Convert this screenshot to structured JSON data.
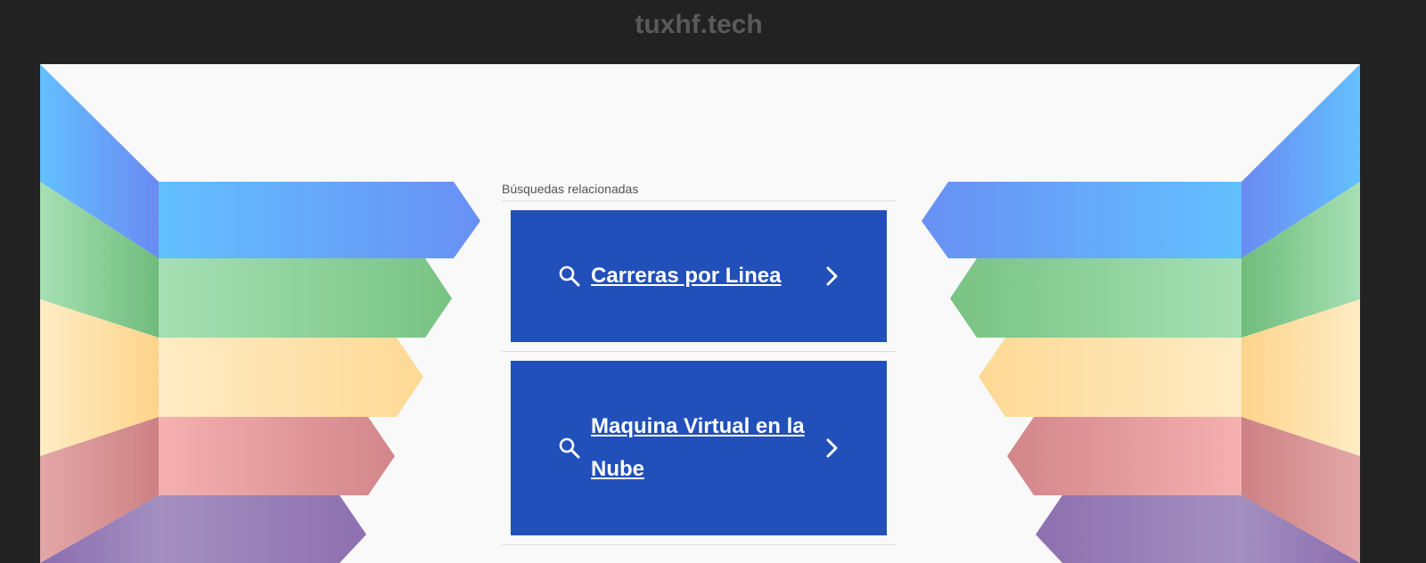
{
  "site": {
    "title": "tuxhf.tech"
  },
  "related": {
    "heading": "Búsquedas relacionadas",
    "items": [
      {
        "label": "Carreras por Linea",
        "icon": "search-icon"
      },
      {
        "label": "Maquina Virtual en la Nube",
        "icon": "search-icon"
      }
    ]
  },
  "colors": {
    "background": "#222222",
    "canvas": "#f9f9f9",
    "result_bg": "#2150bb",
    "stripes": [
      "#63b8fd",
      "#86c88c",
      "#fee0a2",
      "#e4999a",
      "#9a7dbb"
    ]
  }
}
